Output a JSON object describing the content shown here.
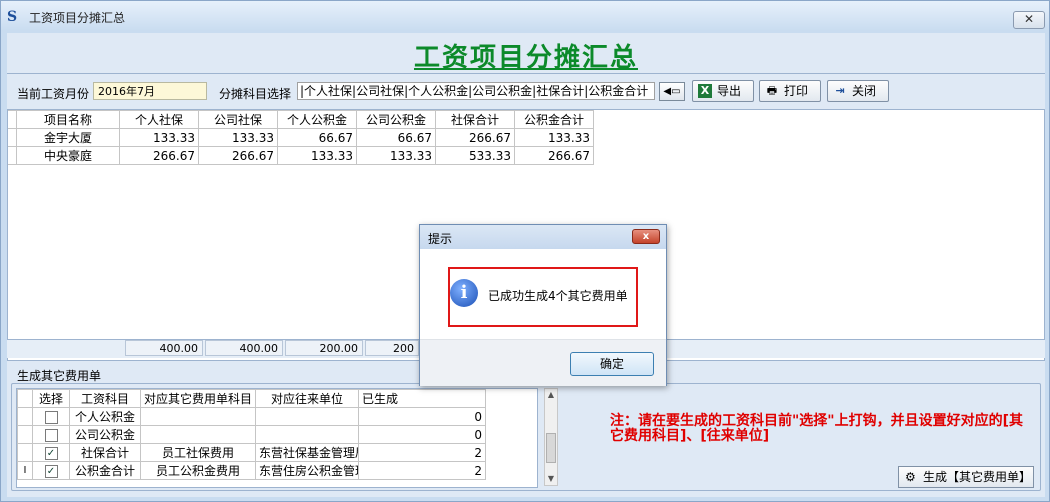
{
  "window": {
    "title": "工资项目分摊汇总",
    "close_glyph": "✕"
  },
  "page": {
    "heading": "工资项目分摊汇总"
  },
  "filters": {
    "month_label": "当前工资月份",
    "month_value": "2016年7月",
    "subject_label": "分摊科目选择",
    "subject_value": "|个人社保|公司社保|个人公积金|公司公积金|社保合计|公积金合计"
  },
  "toolbar": {
    "export_label": "导出",
    "print_label": "打印",
    "close_label": "关闭"
  },
  "summary": {
    "columns": [
      "项目名称",
      "个人社保",
      "公司社保",
      "个人公积金",
      "公司公积金",
      "社保合计",
      "公积金合计"
    ],
    "rows": [
      [
        "金宇大厦",
        "133.33",
        "133.33",
        "66.67",
        "66.67",
        "266.67",
        "133.33"
      ],
      [
        "中央豪庭",
        "266.67",
        "266.67",
        "133.33",
        "133.33",
        "533.33",
        "266.67"
      ]
    ],
    "totals": [
      "400.00",
      "400.00",
      "200.00",
      "200"
    ]
  },
  "lower": {
    "title": "生成其它费用单",
    "columns": [
      "选择",
      "工资科目",
      "对应其它费用单科目",
      "对应往来单位",
      "已生成"
    ],
    "rows": [
      {
        "indicator": "",
        "checked": false,
        "subject": "个人公积金",
        "fee_subject": "",
        "unit": "",
        "count": "0"
      },
      {
        "indicator": "",
        "checked": false,
        "subject": "公司公积金",
        "fee_subject": "",
        "unit": "",
        "count": "0"
      },
      {
        "indicator": "",
        "checked": true,
        "subject": "社保合计",
        "fee_subject": "员工社保费用",
        "unit": "东营社保基金管理局",
        "count": "2"
      },
      {
        "indicator": "I",
        "checked": true,
        "subject": "公积金合计",
        "fee_subject": "员工公积金费用",
        "unit": "东营住房公积金管理",
        "count": "2"
      }
    ],
    "note": "注：请在要生成的工资科目前\"选择\"上打钩，并且设置好对应的[其它费用科目]、[往来单位]",
    "generate_label": "生成【其它费用单】"
  },
  "dialog": {
    "title": "提示",
    "message": "已成功生成4个其它费用单",
    "ok_label": "确定",
    "close_glyph": "x"
  },
  "icons": {
    "app": "app-logo-icon",
    "export": "excel-icon",
    "print": "printer-icon",
    "close": "exit-icon",
    "generate": "generate-icon",
    "info": "info-icon"
  }
}
